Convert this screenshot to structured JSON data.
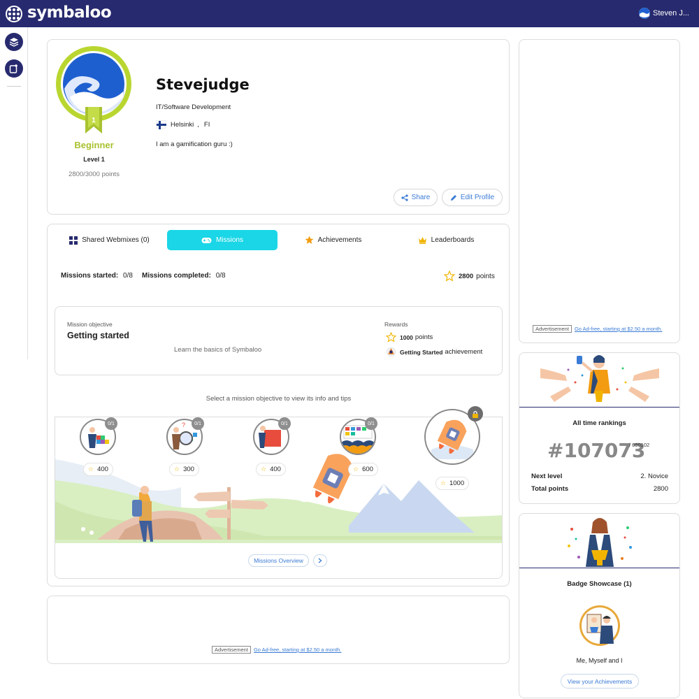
{
  "app": {
    "logo_text": "symbaloo",
    "user_name": "Steven J...",
    "brand_color": "#272a6e",
    "accent_color": "#1ad6e6"
  },
  "profile": {
    "level_name": "Beginner",
    "level_label": "Level 1",
    "level_badge_number": "1",
    "points": "2800/3000 points",
    "name": "Stevejudge",
    "job": "IT/Software Development",
    "city": "Helsinki",
    "country": "FI",
    "bio": "I am a gamification guru :)",
    "share_label": "Share",
    "edit_label": "Edit Profile"
  },
  "tabs": [
    {
      "label": "Shared Webmixes (0)",
      "icon": "grid-icon",
      "active": false
    },
    {
      "label": "Missions",
      "icon": "gamepad-icon",
      "active": true
    },
    {
      "label": "Achievements",
      "icon": "star-icon",
      "active": false
    },
    {
      "label": "Leaderboards",
      "icon": "crown-icon",
      "active": false
    }
  ],
  "missions": {
    "started_label": "Missions started:",
    "started_value": "0/8",
    "completed_label": "Missions completed:",
    "completed_value": "0/8",
    "total_points": "2800",
    "points_word": "points",
    "objective_label": "Mission objective",
    "objective_title": "Getting started",
    "objective_desc": "Learn the basics of Symbaloo",
    "rewards_label": "Rewards",
    "reward_points": "1000",
    "reward_points_word": "points",
    "reward_achievement": "Getting Started",
    "reward_achievement_word": "achievement",
    "hint": "Select a mission objective to view its info and tips",
    "nodes": [
      {
        "count": "0/1",
        "points": "400"
      },
      {
        "count": "0/1",
        "points": "300"
      },
      {
        "count": "0/1",
        "points": "400"
      },
      {
        "count": "0/1",
        "points": "600"
      },
      {
        "count": "",
        "points": "1000",
        "locked": true
      }
    ],
    "overview_label": "Missions Overview"
  },
  "ads": {
    "tag": "Advertisement",
    "link": "Go Ad-free, starting at $2.50 a month."
  },
  "rankings": {
    "title": "All time rankings",
    "rank": "#107073",
    "total": "/ 650102",
    "next_level_label": "Next level",
    "next_level_value": "2. Novice",
    "total_points_label": "Total points",
    "total_points_value": "2800"
  },
  "showcase": {
    "title": "Badge Showcase (1)",
    "badge_name": "Me, Myself and I",
    "view_label": "View your Achievements"
  }
}
